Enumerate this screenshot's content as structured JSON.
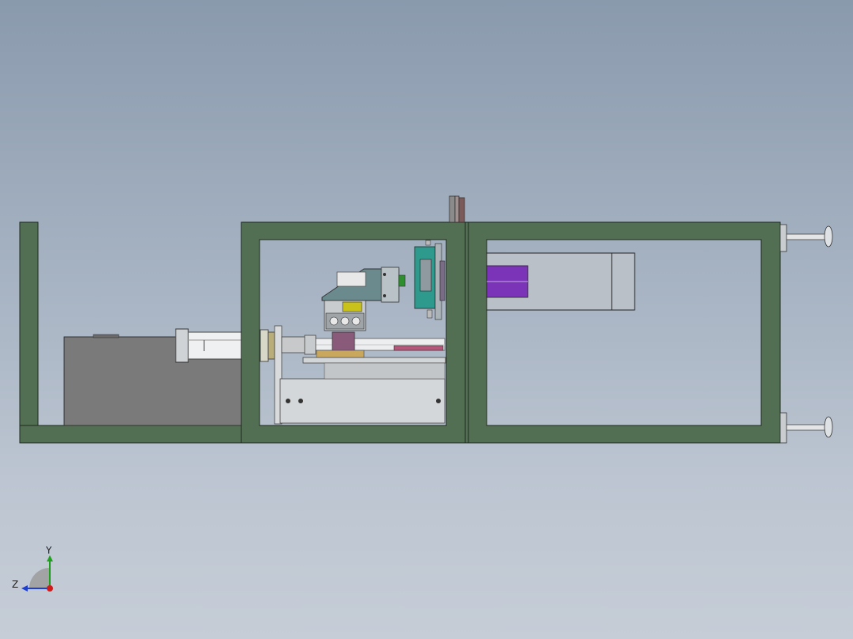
{
  "view": {
    "triad": {
      "y_label": "Y",
      "z_label": "Z"
    }
  },
  "colors": {
    "background_top": "#8a9aad",
    "background_bottom": "#c6cdd7",
    "frame_green": "#536f53",
    "motor_gray": "#7a7a7a",
    "teal": "#2e9a8e",
    "purple": "#7b34b8",
    "yellow": "#c9c21a",
    "axis_y": "#1fa01f",
    "axis_z": "#1f3fd0",
    "axis_x": "#d11a1a"
  }
}
